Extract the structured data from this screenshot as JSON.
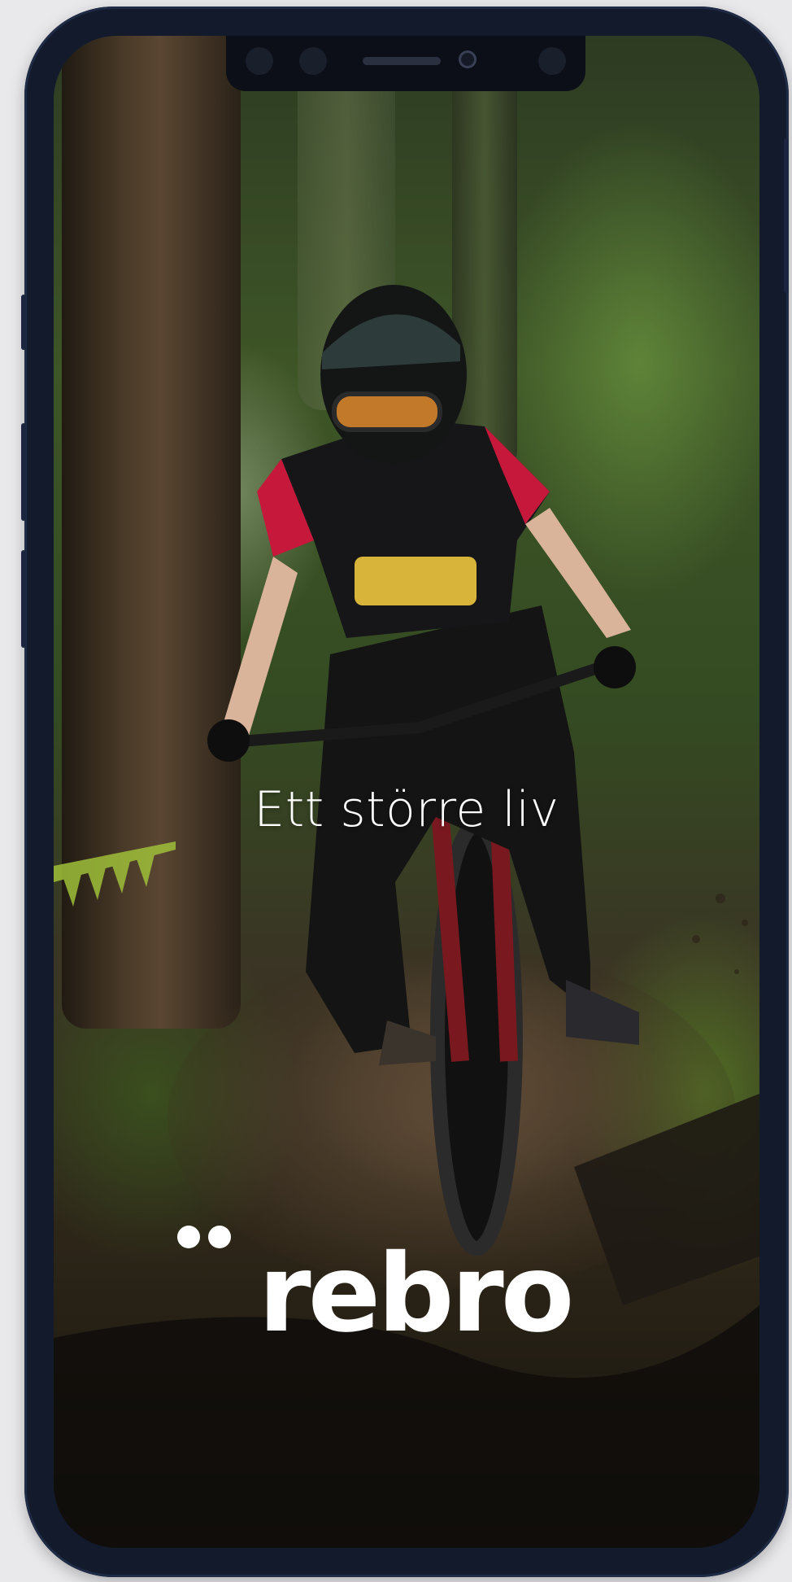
{
  "splash": {
    "tagline": "Ett större liv",
    "brand": {
      "name": "rebro",
      "logo_icon": "two-dots-icon"
    },
    "background_image": "mountain-biker-forest-trail-photo"
  },
  "colors": {
    "frame": "#121a2c",
    "text": "#ffffff",
    "notch": "#0c0f18"
  }
}
